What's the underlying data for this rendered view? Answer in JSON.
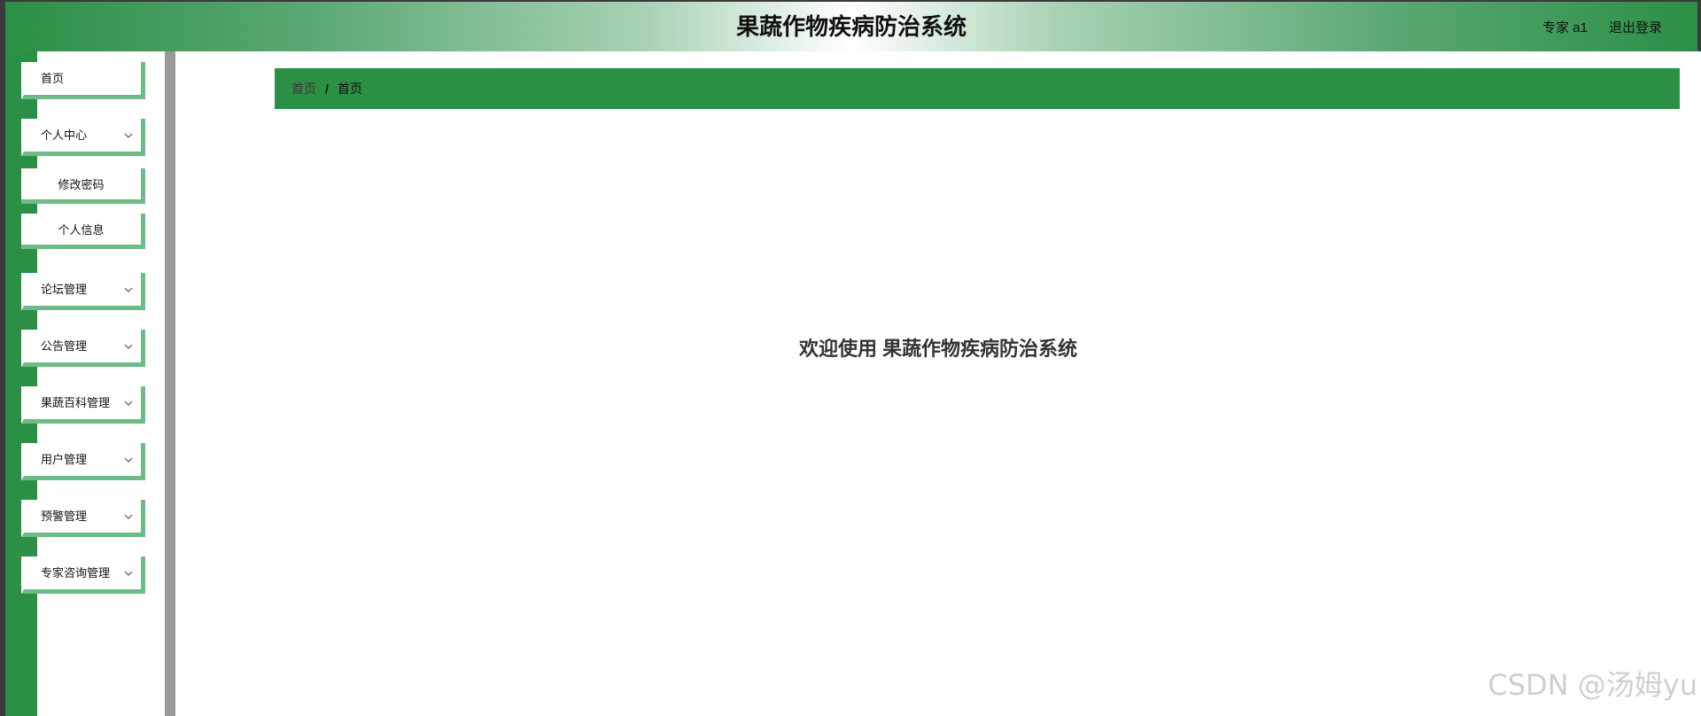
{
  "header": {
    "title": "果蔬作物疾病防治系统",
    "user_label": "专家 a1",
    "logout_label": "退出登录"
  },
  "colors": {
    "primary_green": "#2b8f45",
    "accent_green": "#6dbb86"
  },
  "sidebar": {
    "items": [
      {
        "label": "首页",
        "expandable": false
      },
      {
        "label": "个人中心",
        "expandable": true,
        "expanded": true,
        "children": [
          {
            "label": "修改密码"
          },
          {
            "label": "个人信息"
          }
        ]
      },
      {
        "label": "论坛管理",
        "expandable": true
      },
      {
        "label": "公告管理",
        "expandable": true
      },
      {
        "label": "果蔬百科管理",
        "expandable": true
      },
      {
        "label": "用户管理",
        "expandable": true
      },
      {
        "label": "预警管理",
        "expandable": true
      },
      {
        "label": "专家咨询管理",
        "expandable": true
      }
    ]
  },
  "breadcrumb": {
    "home": "首页",
    "separator": "/",
    "current": "首页"
  },
  "main": {
    "welcome": "欢迎使用 果蔬作物疾病防治系统"
  },
  "watermark": "CSDN @汤姆yu"
}
